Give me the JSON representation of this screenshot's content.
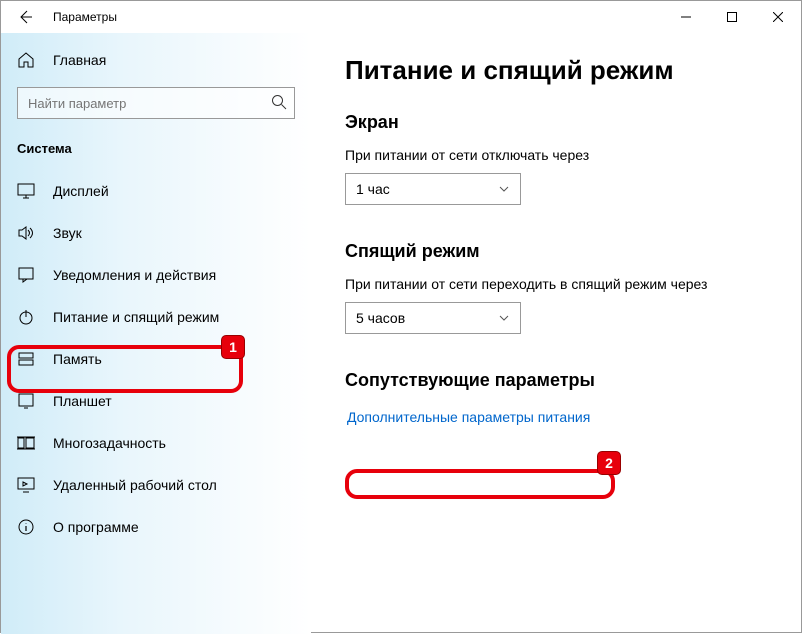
{
  "window": {
    "title": "Параметры"
  },
  "sidebar": {
    "home": "Главная",
    "search_placeholder": "Найти параметр",
    "section": "Система",
    "items": [
      "Дисплей",
      "Звук",
      "Уведомления и действия",
      "Питание и спящий режим",
      "Память",
      "Планшет",
      "Многозадачность",
      "Удаленный рабочий стол",
      "О программе"
    ]
  },
  "main": {
    "heading": "Питание и спящий режим",
    "screen_heading": "Экран",
    "screen_label": "При питании от сети отключать через",
    "screen_value": "1 час",
    "sleep_heading": "Спящий режим",
    "sleep_label": "При питании от сети переходить в спящий режим через",
    "sleep_value": "5 часов",
    "related_heading": "Сопутствующие параметры",
    "related_link": "Дополнительные параметры питания"
  },
  "callouts": {
    "c1": "1",
    "c2": "2"
  }
}
